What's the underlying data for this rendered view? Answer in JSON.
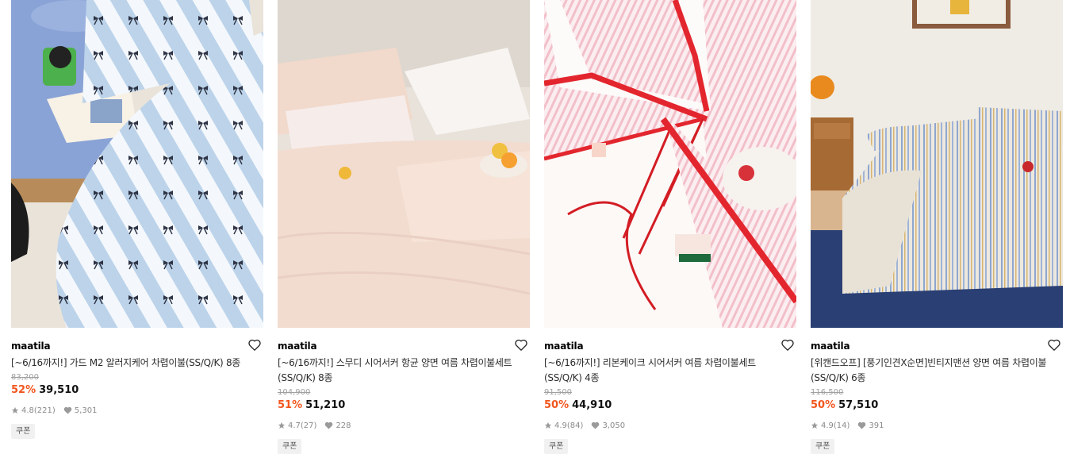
{
  "products": [
    {
      "brand": "maatila",
      "title": "[~6/16까지!] 가드 M2 알러지케어 차렵이불(SS/Q/K) 8종",
      "original_price": "83,200",
      "discount": "52%",
      "price": "39,510",
      "rating": "4.8",
      "reviews": "(221)",
      "likes": "5,301",
      "badge": "쿠폰",
      "image_desc": "blue striped bow pattern comforter"
    },
    {
      "brand": "maatila",
      "title": "[~6/16까지!] 스무디 시어서커 항균 양면 여름 차렵이불세트(SS/Q/K) 8종",
      "original_price": "104,900",
      "discount": "51%",
      "price": "51,210",
      "rating": "4.7",
      "reviews": "(27)",
      "likes": "228",
      "badge": "쿠폰",
      "image_desc": "pale pink seersucker bedding with lemons"
    },
    {
      "brand": "maatila",
      "title": "[~6/16까지!] 리본케이크 시어서커 여름 차렵이불세트(SS/Q/K) 4종",
      "original_price": "91,500",
      "discount": "50%",
      "price": "44,910",
      "rating": "4.9",
      "reviews": "(84)",
      "likes": "3,050",
      "badge": "쿠폰",
      "image_desc": "pink stripe comforter with red ribbon trim"
    },
    {
      "brand": "maatila",
      "title": "[위캔드오프] [풍기인견X순면]빈티지맨션 양면 여름 차렵이불(SS/Q/K) 6종",
      "original_price": "116,500",
      "discount": "50%",
      "price": "57,510",
      "rating": "4.9",
      "reviews": "(14)",
      "likes": "391",
      "badge": "쿠폰",
      "image_desc": "vintage striped bedding in bright room"
    }
  ],
  "colors": {
    "discount": "#f2561d",
    "muted": "#8a8a8a",
    "strike": "#a0a0a0"
  },
  "icons": [
    "heart-outline-icon",
    "star-icon",
    "heart-filled-icon"
  ]
}
